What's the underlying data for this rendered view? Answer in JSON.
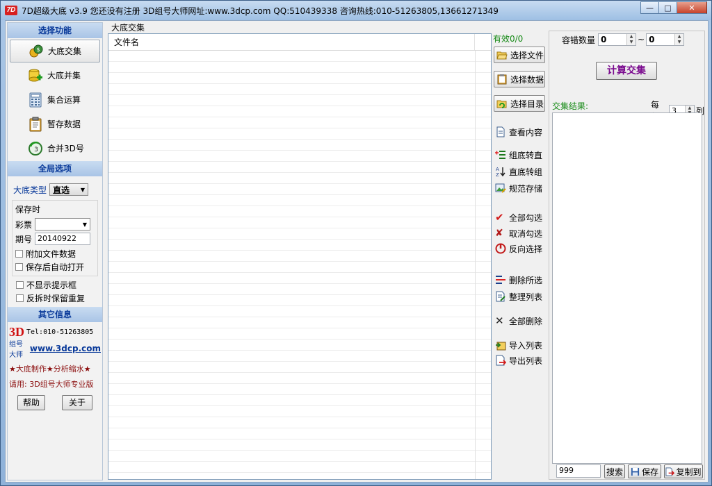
{
  "window": {
    "logo": "7D",
    "title": "7D超级大底 v3.9 您还没有注册 3D组号大师网址:www.3dcp.com QQ:510439338 咨询热线:010-51263805,13661271349",
    "min_glyph": "—",
    "max_glyph": "□",
    "close_glyph": "✕"
  },
  "left": {
    "func_header": "选择功能",
    "functions": [
      {
        "label": "大底交集"
      },
      {
        "label": "大底并集"
      },
      {
        "label": "集合运算"
      },
      {
        "label": "暂存数据"
      },
      {
        "label": "合并3D号"
      }
    ],
    "global_header": "全局选项",
    "type_label": "大底类型",
    "type_value": "直选",
    "save_group_title": "保存时",
    "lottery_label": "彩票",
    "lottery_value": "",
    "period_label": "期号",
    "period_value": "20140922",
    "checks_save": [
      "附加文件数据",
      "保存后自动打开"
    ],
    "checks_misc": [
      "不显示提示框",
      "反拆时保留重复"
    ],
    "other_header": "其它信息",
    "info_3d": "3D",
    "info_tel": "Tel:010-51263805",
    "info_sub": "组号大师",
    "info_url": "www.3dcp.com",
    "info_slogan": "★大底制作★分析缩水★",
    "info_ad": "请用: 3D组号大师专业版",
    "help_label": "帮助",
    "about_label": "关于"
  },
  "middle": {
    "title": "大底交集",
    "column_filename": "文件名"
  },
  "actions": {
    "valid_count": "有效0/0",
    "buttons": [
      "选择文件",
      "选择数据",
      "选择目录"
    ],
    "links": [
      "查看内容",
      "组底转直",
      "直底转组",
      "规范存储",
      "全部勾选",
      "取消勾选",
      "反向选择",
      "删除所选",
      "整理列表",
      "全部删除",
      "导入列表",
      "导出列表"
    ]
  },
  "right": {
    "tolerance_label": "容错数量",
    "tolerance_from": "0",
    "tilde": "~",
    "tolerance_to": "0",
    "calc_label": "计算交集",
    "result_label": "交集结果:",
    "per_row_label": "每行",
    "per_row_value": "3",
    "cols_label": "列",
    "bottom_value": "999",
    "search_label": "搜索",
    "save_label": "保存",
    "copy_label": "复制到"
  }
}
